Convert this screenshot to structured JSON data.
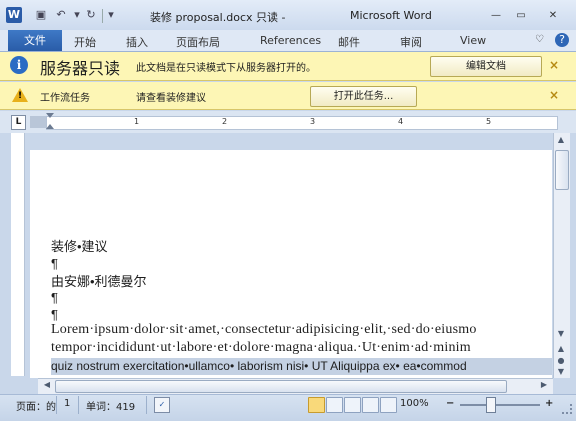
{
  "window": {
    "doc_title": "装修 proposal.docx 只读 -",
    "app_title": "Microsoft Word",
    "app_icon_letter": "W",
    "quick_access": [
      "save-icon",
      "undo-icon",
      "redo-icon",
      "customize-icon"
    ],
    "controls": [
      "minimize",
      "maximize",
      "close"
    ]
  },
  "ribbon": {
    "file_tab": "文件",
    "tabs": [
      "开始",
      "插入",
      "页面布局",
      "References",
      "邮件",
      "审阅",
      "View"
    ],
    "help": "?"
  },
  "info_bar": {
    "title": "服务器只读",
    "message": "此文档是在只读模式下从服务器打开的。",
    "button": "编辑文档",
    "close": "×"
  },
  "workflow_bar": {
    "title": "工作流任务",
    "message": "请查看装修建议",
    "button": "打开此任务...",
    "close": "×"
  },
  "ruler": {
    "toggle": "L",
    "numbers": [
      "1",
      "2",
      "3",
      "4",
      "5"
    ]
  },
  "document": {
    "lines": [
      "装修•建议",
      "¶",
      "由安娜•利德曼尔",
      "¶",
      "¶"
    ],
    "para1_line1": "Lorem·ipsum·dolor·sit·amet,·consectetur·adipisicing·elit,·sed·do·eiusmo",
    "para1_line2": "tempor·incididunt·ut·labore·et·dolore·magna·aliqua.·Ut·enim·ad·minim",
    "selected_line": "quiz nostrum exercitation•ullamco• laborism nisi• UT Aliquippa ex• ea•commod"
  },
  "status_bar": {
    "page_label": "页面：的",
    "page_value": "1",
    "words_label": "单词：419",
    "zoom": "100%",
    "zoom_minus": "−",
    "zoom_plus": "+"
  },
  "colors": {
    "file_tab": "#2a5ca8",
    "infobar": "#fdf6b5",
    "chrome": "#c9d7ea"
  }
}
